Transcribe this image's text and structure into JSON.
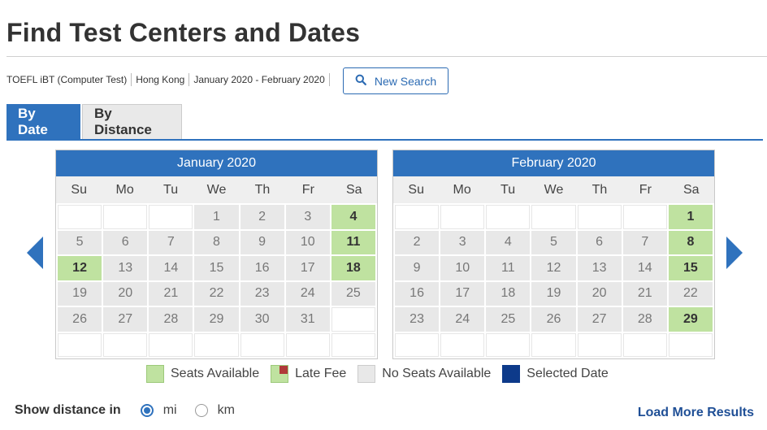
{
  "page": {
    "title": "Find Test Centers and Dates"
  },
  "criteria": [
    "TOEFL iBT (Computer Test)",
    "Hong Kong",
    "January 2020 - February 2020"
  ],
  "new_search": {
    "label": "New Search",
    "icon": "search-icon"
  },
  "tabs": [
    {
      "label": "By Date",
      "active": true
    },
    {
      "label": "By Distance",
      "active": false
    }
  ],
  "colors": {
    "accent": "#2f72bd",
    "available": "#bfe2a0",
    "no_seats": "#e8e8e8",
    "selected": "#0d3a8a",
    "late_fee_marker": "#b03a3a"
  },
  "calendars": [
    {
      "month": "January 2020",
      "weekdays": [
        "Su",
        "Mo",
        "Tu",
        "We",
        "Th",
        "Fr",
        "Sa"
      ],
      "weeks": [
        [
          {
            "d": "",
            "s": "empty"
          },
          {
            "d": "",
            "s": "empty"
          },
          {
            "d": "",
            "s": "empty"
          },
          {
            "d": "1",
            "s": "none"
          },
          {
            "d": "2",
            "s": "none"
          },
          {
            "d": "3",
            "s": "none"
          },
          {
            "d": "4",
            "s": "avail"
          }
        ],
        [
          {
            "d": "5",
            "s": "none"
          },
          {
            "d": "6",
            "s": "none"
          },
          {
            "d": "7",
            "s": "none"
          },
          {
            "d": "8",
            "s": "none"
          },
          {
            "d": "9",
            "s": "none"
          },
          {
            "d": "10",
            "s": "none"
          },
          {
            "d": "11",
            "s": "avail"
          }
        ],
        [
          {
            "d": "12",
            "s": "avail"
          },
          {
            "d": "13",
            "s": "none"
          },
          {
            "d": "14",
            "s": "none"
          },
          {
            "d": "15",
            "s": "none"
          },
          {
            "d": "16",
            "s": "none"
          },
          {
            "d": "17",
            "s": "none"
          },
          {
            "d": "18",
            "s": "avail"
          }
        ],
        [
          {
            "d": "19",
            "s": "none"
          },
          {
            "d": "20",
            "s": "none"
          },
          {
            "d": "21",
            "s": "none"
          },
          {
            "d": "22",
            "s": "none"
          },
          {
            "d": "23",
            "s": "none"
          },
          {
            "d": "24",
            "s": "none"
          },
          {
            "d": "25",
            "s": "none"
          }
        ],
        [
          {
            "d": "26",
            "s": "none"
          },
          {
            "d": "27",
            "s": "none"
          },
          {
            "d": "28",
            "s": "none"
          },
          {
            "d": "29",
            "s": "none"
          },
          {
            "d": "30",
            "s": "none"
          },
          {
            "d": "31",
            "s": "none"
          },
          {
            "d": "",
            "s": "empty"
          }
        ],
        [
          {
            "d": "",
            "s": "empty"
          },
          {
            "d": "",
            "s": "empty"
          },
          {
            "d": "",
            "s": "empty"
          },
          {
            "d": "",
            "s": "empty"
          },
          {
            "d": "",
            "s": "empty"
          },
          {
            "d": "",
            "s": "empty"
          },
          {
            "d": "",
            "s": "empty"
          }
        ]
      ]
    },
    {
      "month": "February 2020",
      "weekdays": [
        "Su",
        "Mo",
        "Tu",
        "We",
        "Th",
        "Fr",
        "Sa"
      ],
      "weeks": [
        [
          {
            "d": "",
            "s": "empty"
          },
          {
            "d": "",
            "s": "empty"
          },
          {
            "d": "",
            "s": "empty"
          },
          {
            "d": "",
            "s": "empty"
          },
          {
            "d": "",
            "s": "empty"
          },
          {
            "d": "",
            "s": "empty"
          },
          {
            "d": "1",
            "s": "avail"
          }
        ],
        [
          {
            "d": "2",
            "s": "none"
          },
          {
            "d": "3",
            "s": "none"
          },
          {
            "d": "4",
            "s": "none"
          },
          {
            "d": "5",
            "s": "none"
          },
          {
            "d": "6",
            "s": "none"
          },
          {
            "d": "7",
            "s": "none"
          },
          {
            "d": "8",
            "s": "avail"
          }
        ],
        [
          {
            "d": "9",
            "s": "none"
          },
          {
            "d": "10",
            "s": "none"
          },
          {
            "d": "11",
            "s": "none"
          },
          {
            "d": "12",
            "s": "none"
          },
          {
            "d": "13",
            "s": "none"
          },
          {
            "d": "14",
            "s": "none"
          },
          {
            "d": "15",
            "s": "avail"
          }
        ],
        [
          {
            "d": "16",
            "s": "none"
          },
          {
            "d": "17",
            "s": "none"
          },
          {
            "d": "18",
            "s": "none"
          },
          {
            "d": "19",
            "s": "none"
          },
          {
            "d": "20",
            "s": "none"
          },
          {
            "d": "21",
            "s": "none"
          },
          {
            "d": "22",
            "s": "none"
          }
        ],
        [
          {
            "d": "23",
            "s": "none"
          },
          {
            "d": "24",
            "s": "none"
          },
          {
            "d": "25",
            "s": "none"
          },
          {
            "d": "26",
            "s": "none"
          },
          {
            "d": "27",
            "s": "none"
          },
          {
            "d": "28",
            "s": "none"
          },
          {
            "d": "29",
            "s": "avail"
          }
        ],
        [
          {
            "d": "",
            "s": "empty"
          },
          {
            "d": "",
            "s": "empty"
          },
          {
            "d": "",
            "s": "empty"
          },
          {
            "d": "",
            "s": "empty"
          },
          {
            "d": "",
            "s": "empty"
          },
          {
            "d": "",
            "s": "empty"
          },
          {
            "d": "",
            "s": "empty"
          }
        ]
      ]
    }
  ],
  "legend": [
    {
      "label": "Seats Available",
      "kind": "avail"
    },
    {
      "label": "Late Fee",
      "kind": "late"
    },
    {
      "label": "No Seats Available",
      "kind": "none"
    },
    {
      "label": "Selected Date",
      "kind": "selected"
    }
  ],
  "distance": {
    "label": "Show distance in",
    "options": [
      {
        "label": "mi",
        "checked": true
      },
      {
        "label": "km",
        "checked": false
      }
    ]
  },
  "load_more": {
    "label": "Load More Results"
  },
  "nav": {
    "prev_icon": "chevron-left-icon",
    "next_icon": "chevron-right-icon"
  }
}
